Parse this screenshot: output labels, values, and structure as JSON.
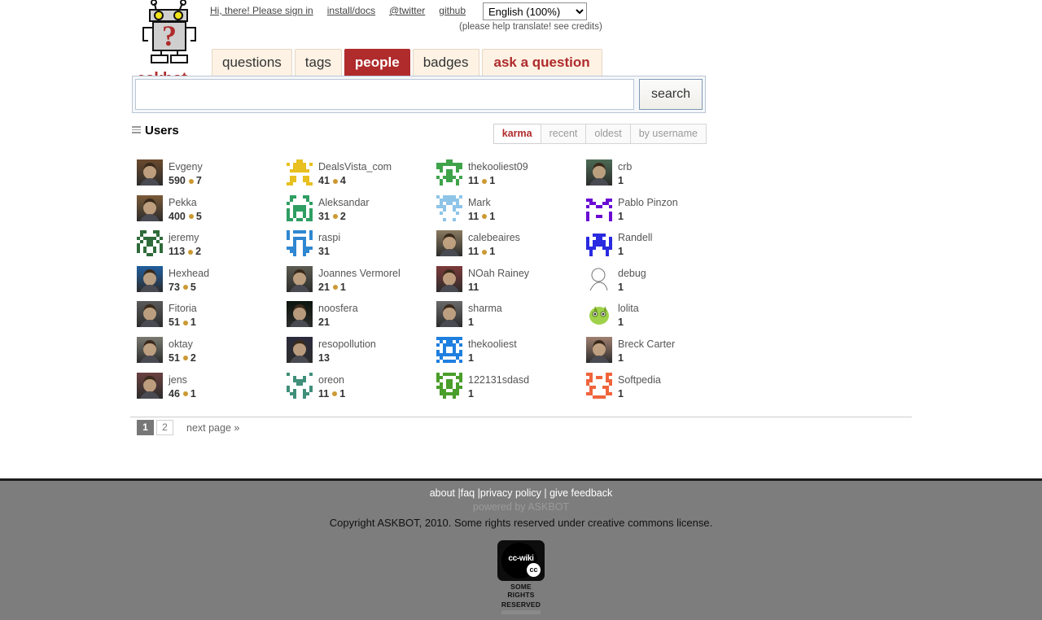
{
  "site": {
    "logo_text": "askbot",
    "logo_icon": "robot-question-mark-icon"
  },
  "header": {
    "links": [
      {
        "label": "Hi, there! Please sign in",
        "name": "sign-in-link"
      },
      {
        "label": "install/docs",
        "name": "install-docs-link"
      },
      {
        "label": "@twitter",
        "name": "twitter-link"
      },
      {
        "label": "github",
        "name": "github-link"
      }
    ],
    "language": {
      "selected": "English (100%)",
      "options": [
        "English (100%)"
      ],
      "note": "(please help translate! see credits)"
    }
  },
  "nav": {
    "tabs": [
      {
        "label": "questions",
        "active": false
      },
      {
        "label": "tags",
        "active": false
      },
      {
        "label": "people",
        "active": true
      },
      {
        "label": "badges",
        "active": false
      },
      {
        "label": "ask a question",
        "active": false,
        "style": "ask"
      }
    ]
  },
  "search": {
    "value": "",
    "placeholder": "",
    "button_label": "search"
  },
  "main": {
    "title": "Users",
    "title_icon": "list-icon",
    "sorts": [
      {
        "label": "karma",
        "active": true
      },
      {
        "label": "recent",
        "active": false
      },
      {
        "label": "oldest",
        "active": false
      },
      {
        "label": "by username",
        "active": false
      }
    ],
    "users": [
      {
        "name": "Evgeny",
        "karma": "590",
        "badges": "7",
        "avatar": "photo",
        "color": "#6b4a2e"
      },
      {
        "name": "DealsVista_com",
        "karma": "41",
        "badges": "4",
        "avatar": "identicon",
        "color": "#e8c020"
      },
      {
        "name": "thekooliest09",
        "karma": "11",
        "badges": "1",
        "avatar": "identicon",
        "color": "#3fa34a"
      },
      {
        "name": "crb",
        "karma": "1",
        "badges": "",
        "avatar": "photo",
        "color": "#4d6b55"
      },
      {
        "name": "Pekka",
        "karma": "400",
        "badges": "5",
        "avatar": "photo",
        "color": "#7a5a38"
      },
      {
        "name": "Aleksandar",
        "karma": "31",
        "badges": "2",
        "avatar": "identicon",
        "color": "#2e9e62"
      },
      {
        "name": "Mark",
        "karma": "11",
        "badges": "1",
        "avatar": "identicon",
        "color": "#8ec4e8"
      },
      {
        "name": "Pablo Pinzon",
        "karma": "1",
        "badges": "",
        "avatar": "identicon",
        "color": "#6a0bd4"
      },
      {
        "name": "jeremy",
        "karma": "113",
        "badges": "2",
        "avatar": "identicon",
        "color": "#2f6b3a"
      },
      {
        "name": "raspi",
        "karma": "31",
        "badges": "",
        "avatar": "identicon",
        "color": "#2f87d1"
      },
      {
        "name": "calebeaires",
        "karma": "11",
        "badges": "1",
        "avatar": "photo",
        "color": "#8a7a60"
      },
      {
        "name": "Randell",
        "karma": "1",
        "badges": "",
        "avatar": "identicon",
        "color": "#2a2ae0"
      },
      {
        "name": "Hexhead",
        "karma": "73",
        "badges": "5",
        "avatar": "photo",
        "color": "#1f5f9e"
      },
      {
        "name": "Joannes Vermorel",
        "karma": "21",
        "badges": "1",
        "avatar": "photo",
        "color": "#5c5c52"
      },
      {
        "name": "NOah Rainey",
        "karma": "11",
        "badges": "",
        "avatar": "photo",
        "color": "#7d3a3a"
      },
      {
        "name": "debug",
        "karma": "1",
        "badges": "",
        "avatar": "sketch",
        "color": "#ffffff"
      },
      {
        "name": "Fitoria",
        "karma": "51",
        "badges": "1",
        "avatar": "photo",
        "color": "#5a5a5a"
      },
      {
        "name": "noosfera",
        "karma": "21",
        "badges": "",
        "avatar": "photo",
        "color": "#0d140d"
      },
      {
        "name": "sharma",
        "karma": "1",
        "badges": "",
        "avatar": "photo",
        "color": "#6a6a6a"
      },
      {
        "name": "lolita",
        "karma": "1",
        "badges": "",
        "avatar": "creature",
        "color": "#9fd14a"
      },
      {
        "name": "oktay",
        "karma": "51",
        "badges": "2",
        "avatar": "photo",
        "color": "#7a7a72"
      },
      {
        "name": "resopollution",
        "karma": "13",
        "badges": "",
        "avatar": "photo",
        "color": "#2b2b3e"
      },
      {
        "name": "thekooliest",
        "karma": "1",
        "badges": "",
        "avatar": "identicon",
        "color": "#1f7fe0"
      },
      {
        "name": "Breck Carter",
        "karma": "1",
        "badges": "",
        "avatar": "photo",
        "color": "#a08070"
      },
      {
        "name": "jens",
        "karma": "46",
        "badges": "1",
        "avatar": "photo",
        "color": "#6a4040"
      },
      {
        "name": "oreon",
        "karma": "11",
        "badges": "1",
        "avatar": "identicon",
        "color": "#3f8f7a"
      },
      {
        "name": "122131sdasd",
        "karma": "1",
        "badges": "",
        "avatar": "identicon",
        "color": "#4a9e2a"
      },
      {
        "name": "Softpedia",
        "karma": "1",
        "badges": "",
        "avatar": "identicon",
        "color": "#f0643c"
      }
    ]
  },
  "pagination": {
    "pages": [
      {
        "label": "1",
        "current": true
      },
      {
        "label": "2",
        "current": false
      }
    ],
    "next_label": "next page »"
  },
  "footer": {
    "links": [
      {
        "label": "about"
      },
      {
        "label": "faq"
      },
      {
        "label": "privacy policy"
      },
      {
        "label": "give feedback"
      }
    ],
    "separator1": " |",
    "separator2": " |",
    "separator3": " | ",
    "powered_prefix": "powered by ",
    "powered_name": "ASKBOT",
    "copyright": "Copyright ASKBOT, 2010. Some rights reserved under creative commons license.",
    "cc_badge": {
      "main": "cc-wiki",
      "mini": "cc",
      "line1": "SOME RIGHTS",
      "line2": "RESERVED"
    }
  },
  "colors": {
    "accent": "#b02b2c",
    "tab_bg": "#fdf2e4",
    "footer_bg": "#7d7d7d",
    "badge_dot": "#cc9933"
  }
}
